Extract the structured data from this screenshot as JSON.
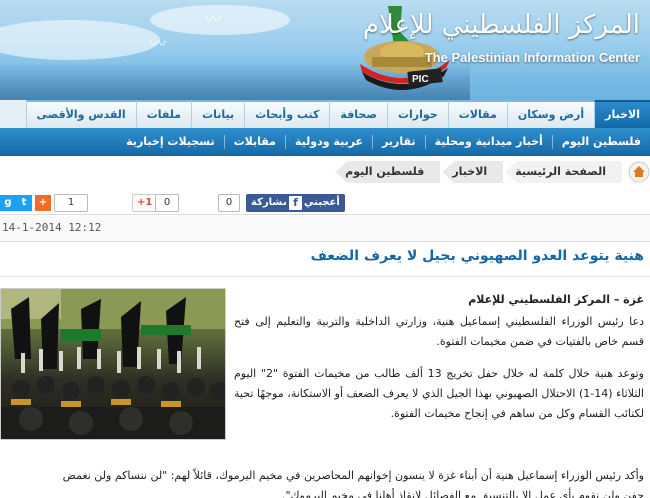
{
  "header": {
    "site_name_ar": "المركز الفلسطيني للإعلام",
    "site_name_en": "The Palestinian Information Center",
    "logo_text": "PIC"
  },
  "nav": {
    "tabs": [
      "الاخبار",
      "أرض وسكان",
      "مقالات",
      "حوارات",
      "صحافة",
      "كتب وأبحاث",
      "بيانات",
      "ملفات",
      "القدس والأقصى"
    ],
    "active_index": 0
  },
  "subnav": {
    "items": [
      "فلسطين اليوم",
      "أخبار ميدانية ومحلية",
      "تقارير",
      "عربية ودولية",
      "مقابلات",
      "تسجيلات إخبارية"
    ]
  },
  "breadcrumb": [
    "الصفحة الرئيسية",
    "الاخبار",
    "فلسطين اليوم"
  ],
  "share": {
    "facebook_label": "أعجبني",
    "share_label": "مشاركة",
    "facebook_count": "0",
    "gplus_label": "+1",
    "gplus_count": "0",
    "addthis_count": "1"
  },
  "article": {
    "datetime": "14-1-2014 12:12",
    "title": "هنية يتوعد العدو الصهيوني بجيل لا يعرف الضعف",
    "source": "غزة – المركز الفلسطيني للإعلام",
    "paragraph1": "دعا رئيس الوزراء الفلسطيني إسماعيل هنية، وزارتي الداخلية والتربية والتعليم إلى فتح قسم خاص بالفتيات في ضمن مخيمات الفتوة.",
    "paragraph2": "وتوعد هنية خلال كلمة له خلال حفل تخريج 13 ألف طالب من مخيمات الفتوة \"2\" اليوم الثلاثاء (14-1) الاحتلال الصهيوني بهذا الجيل الذي لا يعرف الضعف أو الاستكانة، موجهًا تحية لكتائب القسام وكل من ساهم في إنجاح مخيمات الفتوة.",
    "paragraph3": "وأكد رئيس الوزراء إسماعيل هنية أن أبناء غزة لا ينسون إخوانهم المحاصرين في مخيم اليرموك، قائلاً لهم: \"لن ننساكم ولن نغمض",
    "paragraph4": "جفن ولن نقوم بأي عمل إلا بالتنسيق مع الفصائل لإنقاذ أهلنا في مخيم اليرموك\"."
  },
  "colors": {
    "brand_blue": "#1668a6",
    "title_blue": "#1466a8"
  }
}
